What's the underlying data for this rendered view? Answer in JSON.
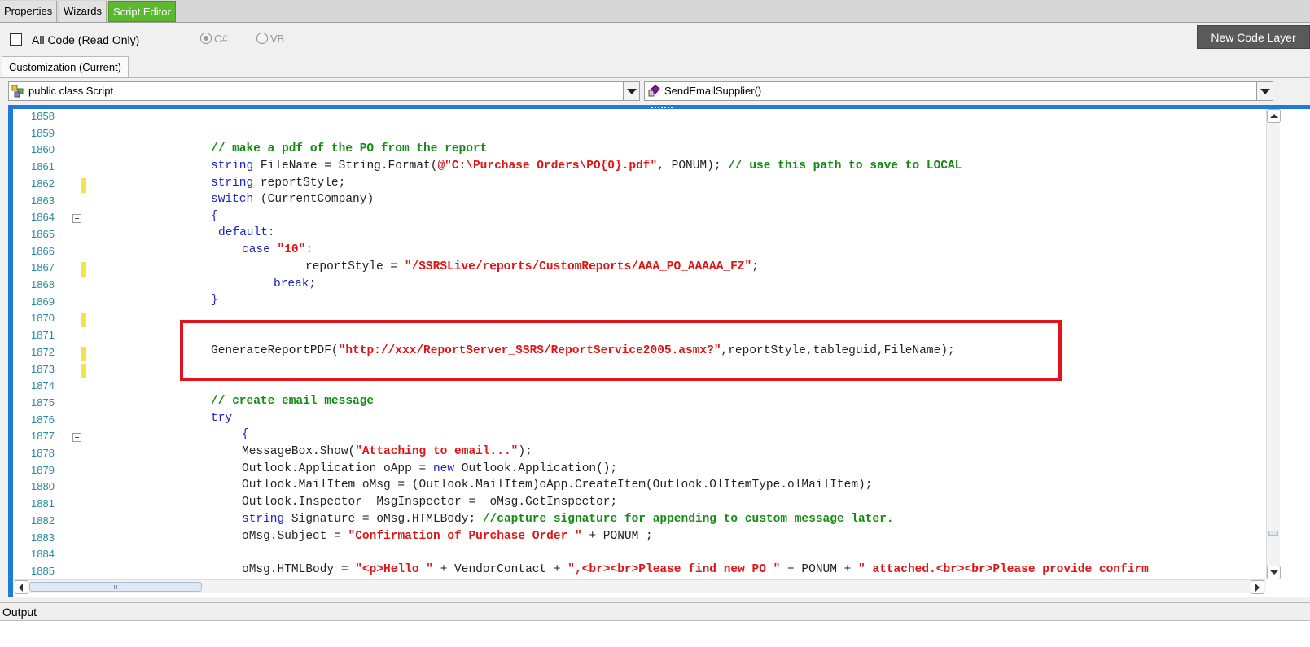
{
  "tabs": [
    {
      "label": "Properties",
      "active": false
    },
    {
      "label": "Wizards",
      "active": false
    },
    {
      "label": "Script Editor",
      "active": true
    }
  ],
  "toolbar": {
    "all_code_label": "All Code (Read Only)",
    "all_code_checked": false,
    "radio_csharp": "C#",
    "radio_vb": "VB",
    "selected_language": "C#",
    "new_code_layer": "New Code Layer"
  },
  "customization_tab": "Customization (Current)",
  "class_dropdown": {
    "icon": "class-icon",
    "value": "public class Script"
  },
  "member_dropdown": {
    "icon": "method-icon",
    "value": "SendEmailSupplier()"
  },
  "editor": {
    "line_numbers": [
      "1858",
      "1859",
      "1860",
      "1861",
      "1862",
      "1863",
      "1864",
      "1865",
      "1866",
      "1867",
      "1868",
      "1869",
      "1870",
      "1871",
      "1872",
      "1873",
      "1874",
      "1875",
      "1876",
      "1877",
      "1878",
      "1879",
      "1880",
      "1881",
      "1882",
      "1883",
      "1884",
      "1885"
    ],
    "changed_lines": [
      "1862",
      "1867",
      "1870",
      "1872",
      "1873"
    ],
    "collapsible_lines": [
      "1864",
      "1877"
    ],
    "code": {
      "l1860": "// make a pdf of the PO from the report",
      "l1861_a": "string",
      "l1861_b": " FileName = String.Format(",
      "l1861_c": "@\"C:\\Purchase Orders\\PO{0}.pdf\"",
      "l1861_d": ", PONUM); ",
      "l1861_e": "// use this path to save to LOCAL",
      "l1862_a": "string",
      "l1862_b": " reportStyle;",
      "l1863_a": "switch",
      "l1863_b": " (CurrentCompany)",
      "l1864": "{",
      "l1865": "default:",
      "l1866_a": "case",
      "l1866_b": "\"10\"",
      "l1866_c": ":",
      "l1867_a": "reportStyle = ",
      "l1867_b": "\"/SSRSLive/reports/CustomReports/AAA_PO_AAAAA_FZ\"",
      "l1867_c": ";",
      "l1868": "break;",
      "l1869": "}",
      "l1872_a": "GenerateReportPDF(",
      "l1872_b": "\"http://xxx/ReportServer_SSRS/ReportService2005.asmx?\"",
      "l1872_c": ",reportStyle,tableguid,FileName);",
      "l1875": "// create email message",
      "l1876": "try",
      "l1877": "{",
      "l1878_a": "MessageBox.Show(",
      "l1878_b": "\"Attaching to email...\"",
      "l1878_c": ");",
      "l1879_a": "Outlook.Application oApp = ",
      "l1879_b": "new",
      "l1879_c": " Outlook.Application();",
      "l1880": "Outlook.MailItem oMsg = (Outlook.MailItem)oApp.CreateItem(Outlook.OlItemType.olMailItem);",
      "l1881": "Outlook.Inspector  MsgInspector =  oMsg.GetInspector;",
      "l1882_a": "string",
      "l1882_b": " Signature = oMsg.HTMLBody; ",
      "l1882_c": "//capture signature for appending to custom message later.",
      "l1883_a": "oMsg.Subject = ",
      "l1883_b": "\"Confirmation of Purchase Order \"",
      "l1883_c": " + PONUM ;",
      "l1885_a": "oMsg.HTMLBody = ",
      "l1885_b": "\"<p>Hello \"",
      "l1885_c": " + VendorContact + ",
      "l1885_d": "\",<br><br>Please find new PO \"",
      "l1885_e": " + PONUM + ",
      "l1885_f": "\" attached.<br><br>Please provide confirm"
    }
  },
  "output_label": "Output",
  "colors": {
    "accent_tab": "#5cb82e",
    "editor_bar": "#1f7bd6",
    "keyword": "#1a22c7",
    "string": "#e01414",
    "comment": "#148c14",
    "highlight_box": "#e0141c",
    "change_marker": "#f2e24c"
  }
}
